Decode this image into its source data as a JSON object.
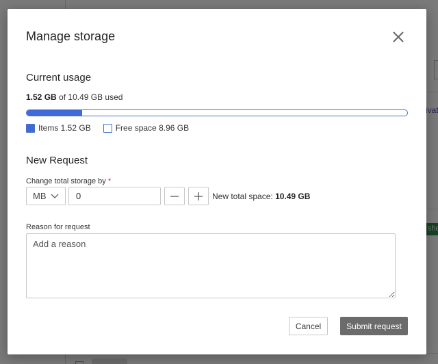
{
  "background": {
    "tag_privat": "rivat",
    "tag_green": "she",
    "arrow": "›"
  },
  "dialog": {
    "title": "Manage storage",
    "current_usage": {
      "heading": "Current usage",
      "used_amount": "1.52 GB",
      "used_suffix": "of 10.49 GB used",
      "used_fraction": 0.145,
      "legend_items": "Items 1.52 GB",
      "legend_free": "Free space 8.96 GB"
    },
    "new_request": {
      "heading": "New Request",
      "change_label": "Change total storage by",
      "required_mark": "*",
      "unit_value": "MB",
      "amount_value": "0",
      "new_total_label": "New total space:",
      "new_total_value": "10.49 GB",
      "reason_label": "Reason for request",
      "reason_placeholder": "Add a reason"
    },
    "buttons": {
      "cancel": "Cancel",
      "submit": "Submit request"
    }
  },
  "colors": {
    "accent": "#3f6ad8",
    "submit_bg": "#6b6b6b",
    "required": "#c0392b"
  },
  "icons": {
    "close": "close-icon",
    "chevron": "chevron-down-icon",
    "minus": "minus-icon",
    "plus": "plus-icon"
  }
}
